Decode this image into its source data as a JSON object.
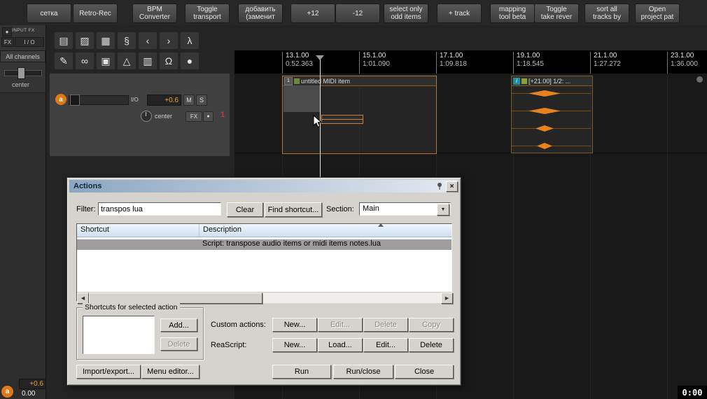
{
  "top_toolbar": {
    "buttons": [
      "сетка",
      "Retro-Rec",
      "BPM\nConverter",
      "Toggle\ntransport",
      "добавить\n(заменит",
      "+12",
      "-12",
      "select only\nodd items",
      "+ track",
      "mapping\ntool beta",
      "Toggle\ntake rever",
      "sort all\ntracks by",
      "Open\nproject pat"
    ]
  },
  "icon_toolbar": {
    "row1": [
      {
        "name": "document-icon",
        "glyph": "▤"
      },
      {
        "name": "open-project-icon",
        "glyph": "▨"
      },
      {
        "name": "save-icon",
        "glyph": "▦"
      },
      {
        "name": "paperclip-icon",
        "glyph": "§"
      },
      {
        "name": "nav-left-icon",
        "glyph": "‹"
      },
      {
        "name": "nav-right-icon",
        "glyph": "›"
      },
      {
        "name": "metronome-icon",
        "glyph": "λ"
      }
    ],
    "row2": [
      {
        "name": "pencil-icon",
        "glyph": "✎"
      },
      {
        "name": "link-icon",
        "glyph": "∞"
      },
      {
        "name": "grid-items-icon",
        "glyph": "▣"
      },
      {
        "name": "envelope-icon",
        "glyph": "△"
      },
      {
        "name": "grid-lines-icon",
        "glyph": "▥"
      },
      {
        "name": "omega-icon",
        "glyph": "Ω"
      },
      {
        "name": "lock-icon",
        "glyph": "●"
      }
    ]
  },
  "sidebar": {
    "input_fx": "INPUT FX",
    "fx": "FX",
    "io": "I / O",
    "all_channels": "All channels",
    "pan": "center",
    "volume": "+0.6",
    "pan_value": "0.00",
    "badge": "a"
  },
  "tcp": {
    "badge": "a",
    "io": "I/O",
    "volume": "+0.6",
    "mute": "M",
    "solo": "S",
    "pan": "center",
    "fx": "FX",
    "track_number": "1"
  },
  "timeline": {
    "markers": [
      {
        "bar": "13.1.00",
        "time": "0:52.363"
      },
      {
        "bar": "15.1.00",
        "time": "1:01.090"
      },
      {
        "bar": "17.1.00",
        "time": "1:09.818"
      },
      {
        "bar": "19.1.00",
        "time": "1:18.545"
      },
      {
        "bar": "21.1.00",
        "time": "1:27.272"
      },
      {
        "bar": "23.1.00",
        "time": "1:36.000"
      }
    ]
  },
  "items": {
    "midi": {
      "index": "1",
      "title": "untitled MIDI item"
    },
    "take": {
      "info": "i",
      "title": "[+21.00] 1/2: ..."
    }
  },
  "dialog": {
    "title": "Actions",
    "filter_label": "Filter:",
    "filter_value": "transpos lua",
    "clear": "Clear",
    "find_shortcut": "Find shortcut...",
    "section_label": "Section:",
    "section_value": "Main",
    "col_shortcut": "Shortcut",
    "col_description": "Description",
    "row_description": "Script: transpose audio items or midi items notes.lua",
    "group_title": "Shortcuts for selected action",
    "add": "Add...",
    "delete": "Delete",
    "custom_label": "Custom actions:",
    "custom_new": "New...",
    "custom_edit": "Edit...",
    "custom_delete": "Delete",
    "custom_copy": "Copy",
    "reascript_label": "ReaScript:",
    "rs_new": "New...",
    "rs_load": "Load...",
    "rs_edit": "Edit...",
    "rs_delete": "Delete",
    "import_export": "Import/export...",
    "menu_editor": "Menu editor...",
    "run": "Run",
    "run_close": "Run/close",
    "close_btn": "Close",
    "glyphs": {
      "close": "×",
      "combo_arrow": "▼",
      "scroll_left": "◀",
      "scroll_right": "▶"
    }
  },
  "transport": {
    "time": "0:00"
  }
}
